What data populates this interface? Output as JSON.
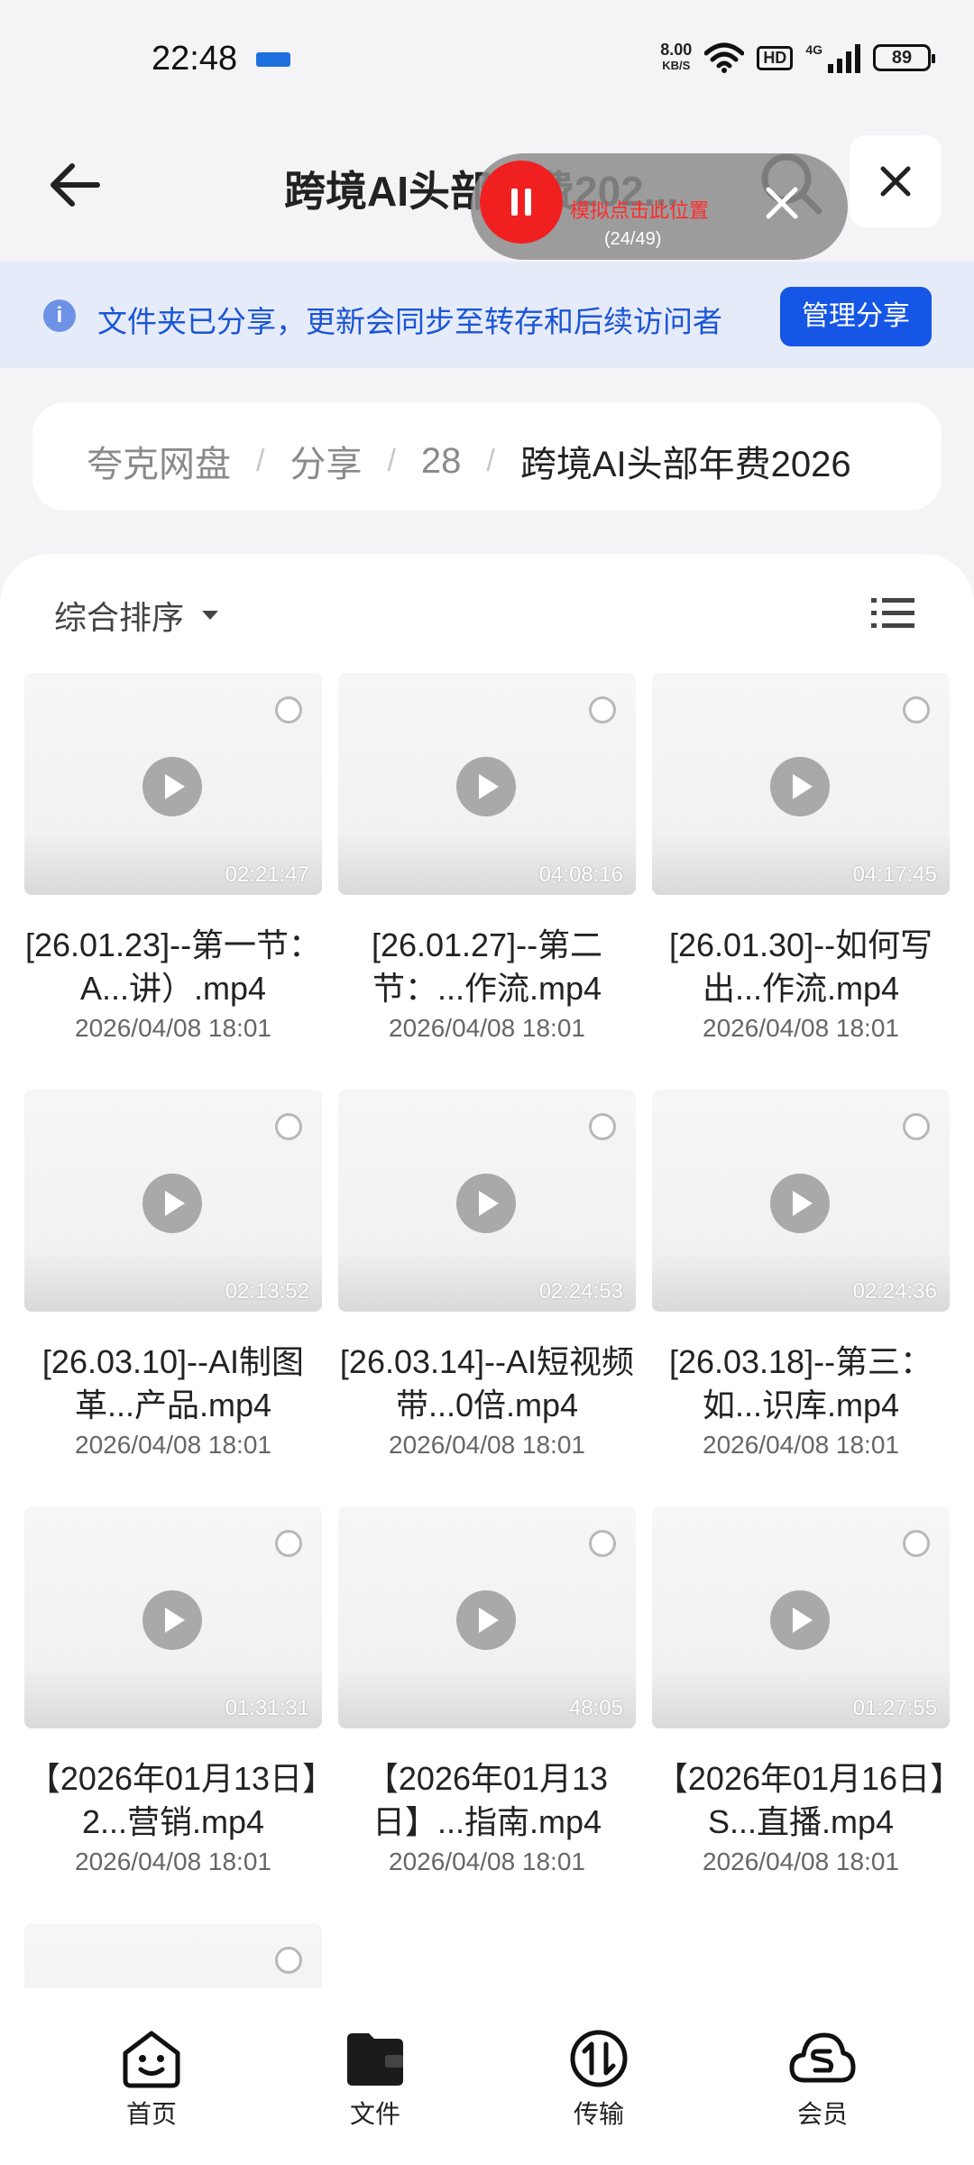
{
  "status": {
    "time": "22:48",
    "speed_top": "8.00",
    "speed_bottom": "KB/S",
    "hd": "HD",
    "network": "4G",
    "battery": "89"
  },
  "header": {
    "title": "跨境AI头部年费202..."
  },
  "overlay": {
    "tip": "模拟点击此位置",
    "count": "(24/49)"
  },
  "banner": {
    "text": "文件夹已分享，更新会同步至转存和后续访问者",
    "button": "管理分享"
  },
  "breadcrumb": {
    "items": [
      "夸克网盘",
      "分享",
      "28"
    ],
    "current": "跨境AI头部年费2026"
  },
  "toolbar": {
    "sort_label": "综合排序"
  },
  "files": [
    {
      "name": "[26.01.23]--第一节：A...讲）.mp4",
      "duration": "02:21:47",
      "date": "2026/04/08 18:01"
    },
    {
      "name": "[26.01.27]--第二节：...作流.mp4",
      "duration": "04:08:16",
      "date": "2026/04/08 18:01"
    },
    {
      "name": "[26.01.30]--如何写出...作流.mp4",
      "duration": "04:17:45",
      "date": "2026/04/08 18:01"
    },
    {
      "name": "[26.03.10]--AI制图革...产品.mp4",
      "duration": "02:13:52",
      "date": "2026/04/08 18:01"
    },
    {
      "name": "[26.03.14]--AI短视频带...0倍.mp4",
      "duration": "02:24:53",
      "date": "2026/04/08 18:01"
    },
    {
      "name": "[26.03.18]--第三：如...识库.mp4",
      "duration": "02:24:36",
      "date": "2026/04/08 18:01"
    },
    {
      "name": "【2026年01月13日】2...营销.mp4",
      "duration": "01:31:31",
      "date": "2026/04/08 18:01"
    },
    {
      "name": "【2026年01月13日】...指南.mp4",
      "duration": "48:05",
      "date": "2026/04/08 18:01"
    },
    {
      "name": "【2026年01月16日】S...直播.mp4",
      "duration": "01:27:55",
      "date": "2026/04/08 18:01"
    }
  ],
  "nav": {
    "home": "首页",
    "files": "文件",
    "transfer": "传输",
    "member": "会员"
  }
}
